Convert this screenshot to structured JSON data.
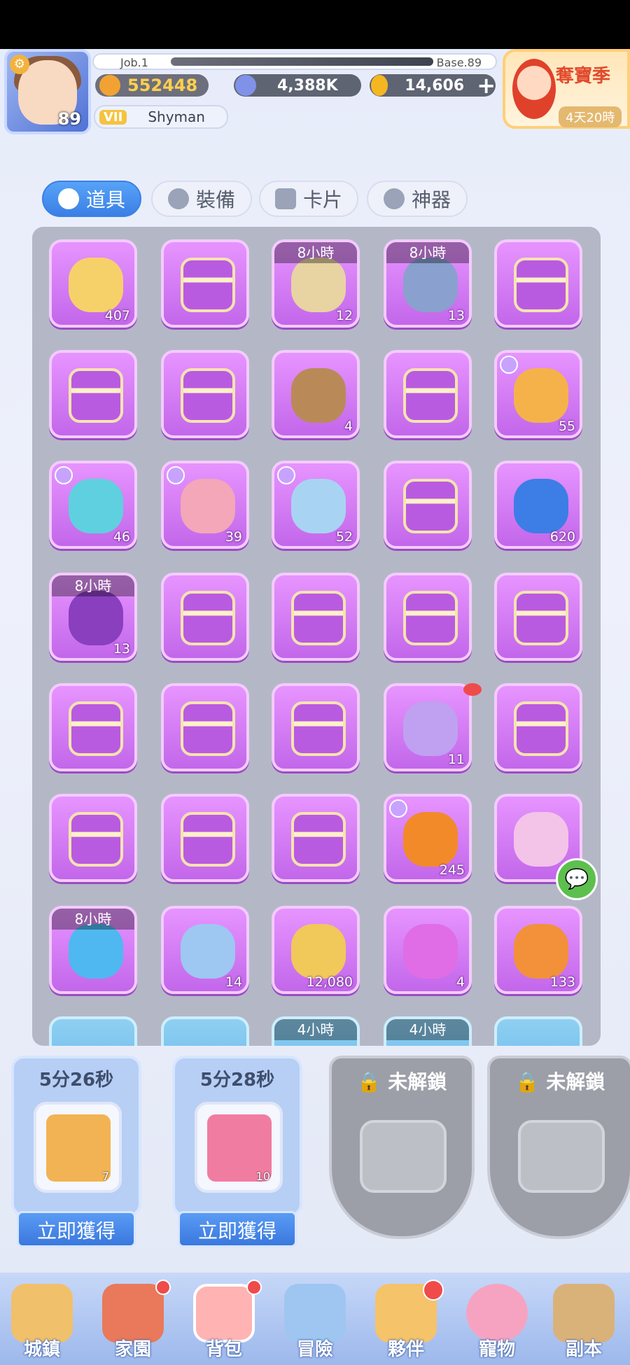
{
  "player": {
    "level": "89",
    "name": "Shyman",
    "vip": "VII",
    "power": "552448",
    "job": "Job.1",
    "base": "Base.89"
  },
  "currency": {
    "zeny": "4,388K",
    "gold": "14,606",
    "add": "+"
  },
  "season": {
    "title": "奪寶季",
    "time": "4天20時"
  },
  "tabs": [
    {
      "label": "道具"
    },
    {
      "label": "裝備"
    },
    {
      "label": "卡片"
    },
    {
      "label": "神器"
    }
  ],
  "items": [
    {
      "icon": "potion-icon",
      "qty": "407",
      "timer": ""
    },
    {
      "icon": "chest-icon",
      "qty": "",
      "timer": ""
    },
    {
      "icon": "scroll-icon",
      "qty": "12",
      "timer": "8小時"
    },
    {
      "icon": "coins-icon",
      "qty": "13",
      "timer": "8小時"
    },
    {
      "icon": "chest-icon",
      "qty": "",
      "timer": ""
    },
    {
      "icon": "chest-icon",
      "qty": "",
      "timer": ""
    },
    {
      "icon": "chest-icon",
      "qty": "",
      "timer": ""
    },
    {
      "icon": "toolbox-icon",
      "qty": "4",
      "timer": ""
    },
    {
      "icon": "chest-icon",
      "qty": "",
      "timer": ""
    },
    {
      "icon": "party-popper-icon",
      "qty": "55",
      "timer": ""
    },
    {
      "icon": "balloons-icon",
      "qty": "46",
      "timer": ""
    },
    {
      "icon": "cake-icon",
      "qty": "39",
      "timer": ""
    },
    {
      "icon": "gift-box-icon",
      "qty": "52",
      "timer": ""
    },
    {
      "icon": "chest-icon",
      "qty": "",
      "timer": ""
    },
    {
      "icon": "water-drop-icon",
      "qty": "620",
      "timer": ""
    },
    {
      "icon": "flask-icon",
      "qty": "13",
      "timer": "8小時"
    },
    {
      "icon": "chest-icon",
      "qty": "",
      "timer": ""
    },
    {
      "icon": "chest-icon",
      "qty": "",
      "timer": ""
    },
    {
      "icon": "chest-icon",
      "qty": "",
      "timer": ""
    },
    {
      "icon": "chest-icon",
      "qty": "",
      "timer": ""
    },
    {
      "icon": "chest-icon",
      "qty": "",
      "timer": ""
    },
    {
      "icon": "chest-icon",
      "qty": "",
      "timer": ""
    },
    {
      "icon": "chest-icon",
      "qty": "",
      "timer": ""
    },
    {
      "icon": "present-icon",
      "qty": "11",
      "timer": ""
    },
    {
      "icon": "chest-icon",
      "qty": "",
      "timer": ""
    },
    {
      "icon": "chest-icon",
      "qty": "",
      "timer": ""
    },
    {
      "icon": "chest-icon",
      "qty": "",
      "timer": ""
    },
    {
      "icon": "chest-icon",
      "qty": "",
      "timer": ""
    },
    {
      "icon": "badge-icon",
      "qty": "245",
      "timer": ""
    },
    {
      "icon": "vial-icon",
      "qty": "",
      "timer": ""
    },
    {
      "icon": "star-icon",
      "qty": "",
      "timer": "8小時"
    },
    {
      "icon": "puzzle-piece-icon",
      "qty": "14",
      "timer": ""
    },
    {
      "icon": "anchor-coin-icon",
      "qty": "12,080",
      "timer": ""
    },
    {
      "icon": "paw-puzzle-icon",
      "qty": "4",
      "timer": ""
    },
    {
      "icon": "crystal-icon",
      "qty": "133",
      "timer": ""
    }
  ],
  "partial_row": [
    {
      "timer": ""
    },
    {
      "timer": ""
    },
    {
      "timer": "4小時"
    },
    {
      "timer": "4小時"
    },
    {
      "timer": ""
    }
  ],
  "queue": [
    {
      "time": "5分26秒",
      "qty": "7",
      "button": "立即獲得"
    },
    {
      "time": "5分28秒",
      "qty": "10",
      "button": "立即獲得"
    }
  ],
  "locked": [
    {
      "label": "未解鎖"
    },
    {
      "label": "未解鎖"
    }
  ],
  "nav": [
    {
      "label": "城鎮"
    },
    {
      "label": "家園"
    },
    {
      "label": "背包"
    },
    {
      "label": "冒險"
    },
    {
      "label": "夥伴"
    },
    {
      "label": "寵物"
    },
    {
      "label": "副本"
    }
  ],
  "colors": {
    "accent": "#3b7fe6",
    "slot": "#c267ea",
    "red_dot": "#ef4b4b"
  }
}
